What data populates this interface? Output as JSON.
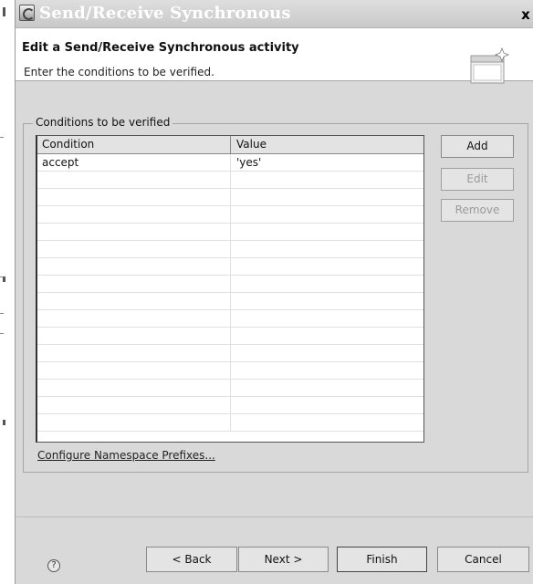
{
  "window": {
    "title": "Send/Receive Synchronous",
    "close_label": "x",
    "app_icon": "eclipse-dialog-icon"
  },
  "header": {
    "title": "Edit a Send/Receive Synchronous activity",
    "description": "Enter the conditions to be verified.",
    "icon": "wizard-banner-icon"
  },
  "conditions": {
    "group_label": "Conditions to be verified",
    "columns": [
      "Condition",
      "Value"
    ],
    "rows": [
      [
        "accept",
        "'yes'"
      ],
      [
        "",
        ""
      ],
      [
        "",
        ""
      ],
      [
        "",
        ""
      ],
      [
        "",
        ""
      ],
      [
        "",
        ""
      ],
      [
        "",
        ""
      ],
      [
        "",
        ""
      ],
      [
        "",
        ""
      ],
      [
        "",
        ""
      ],
      [
        "",
        ""
      ],
      [
        "",
        ""
      ],
      [
        "",
        ""
      ],
      [
        "",
        ""
      ],
      [
        "",
        ""
      ],
      [
        "",
        ""
      ]
    ],
    "buttons": {
      "add": "Add",
      "edit": "Edit",
      "remove": "Remove"
    },
    "button_states": {
      "add": "enabled",
      "edit": "disabled",
      "remove": "disabled"
    },
    "namespace_link": "Configure Namespace Prefixes..."
  },
  "footer": {
    "help_icon": "?",
    "back": "< Back",
    "next": "Next >",
    "finish": "Finish",
    "cancel": "Cancel"
  },
  "colors": {
    "dialog_bg": "#d9d9d9",
    "header_bg": "#ffffff",
    "title_text": "#ffffff",
    "disabled_text": "#9a9a9a"
  }
}
